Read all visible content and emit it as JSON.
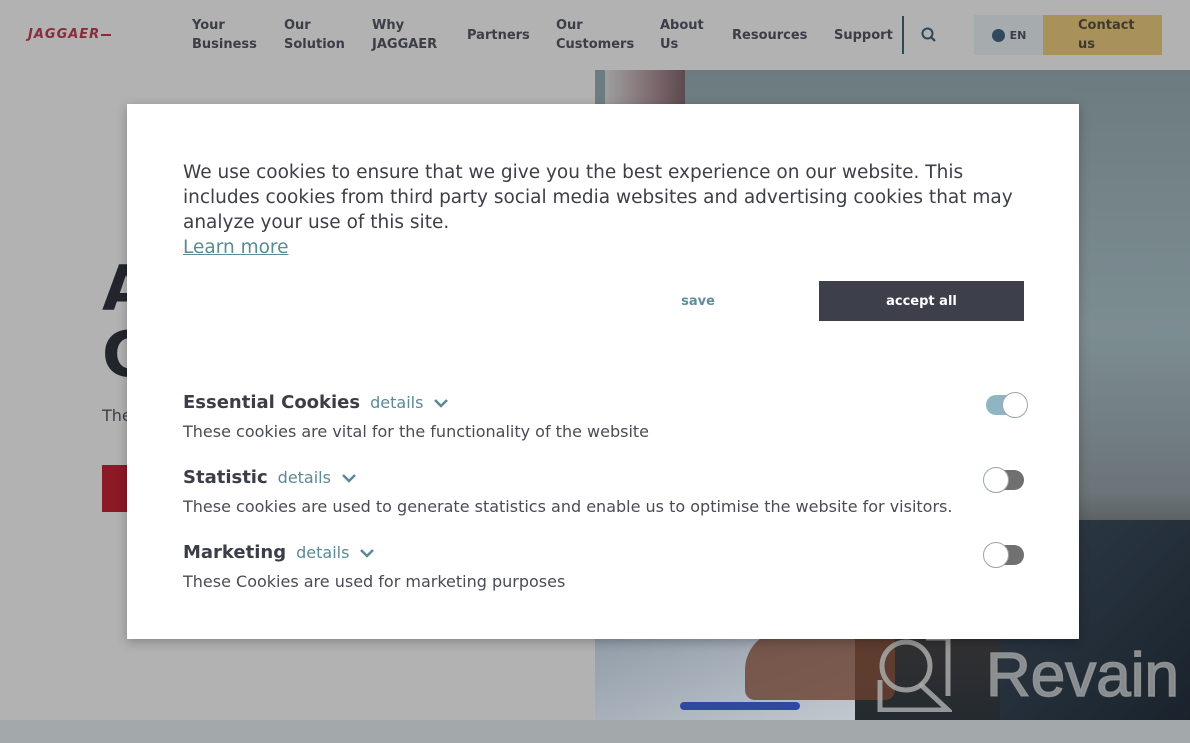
{
  "brand": {
    "logo_text": "JAGGAER",
    "accent_color": "#8b1a26",
    "contact_color": "#a8925a"
  },
  "nav": {
    "items": [
      {
        "line1": "Your",
        "line2": "Business"
      },
      {
        "line1": "Our",
        "line2": "Solution"
      },
      {
        "line1": "Why",
        "line2": "JAGGAER"
      },
      {
        "line1": "Partners",
        "line2": ""
      },
      {
        "line1": "Our",
        "line2": "Customers"
      },
      {
        "line1": "About",
        "line2": "Us"
      },
      {
        "line1": "Resources",
        "line2": ""
      },
      {
        "line1": "Support",
        "line2": ""
      }
    ],
    "search_icon": "search-icon",
    "language": "EN",
    "language_icon": "globe-icon",
    "contact": {
      "line1": "Contact",
      "line2": "us"
    }
  },
  "hero": {
    "title_line1": "A",
    "title_line2": "C",
    "subtitle": "The"
  },
  "cookie_modal": {
    "intro": "We use cookies to ensure that we give you the best experience on our website. This includes cookies from third party social media websites and advertising cookies that may analyze your use of this site.",
    "learn_more": "Learn more",
    "save_label": "save",
    "accept_all_label": "accept all",
    "categories": [
      {
        "title": "Essential Cookies",
        "details": "details",
        "description": "These cookies are vital for the functionality of the website",
        "enabled": true
      },
      {
        "title": "Statistic",
        "details": "details",
        "description": "These cookies are used to generate statistics and enable us to optimise the website for visitors.",
        "enabled": false
      },
      {
        "title": "Marketing",
        "details": "details",
        "description": "These Cookies are used for marketing purposes",
        "enabled": false
      }
    ]
  },
  "watermark": {
    "text": "Revain"
  }
}
